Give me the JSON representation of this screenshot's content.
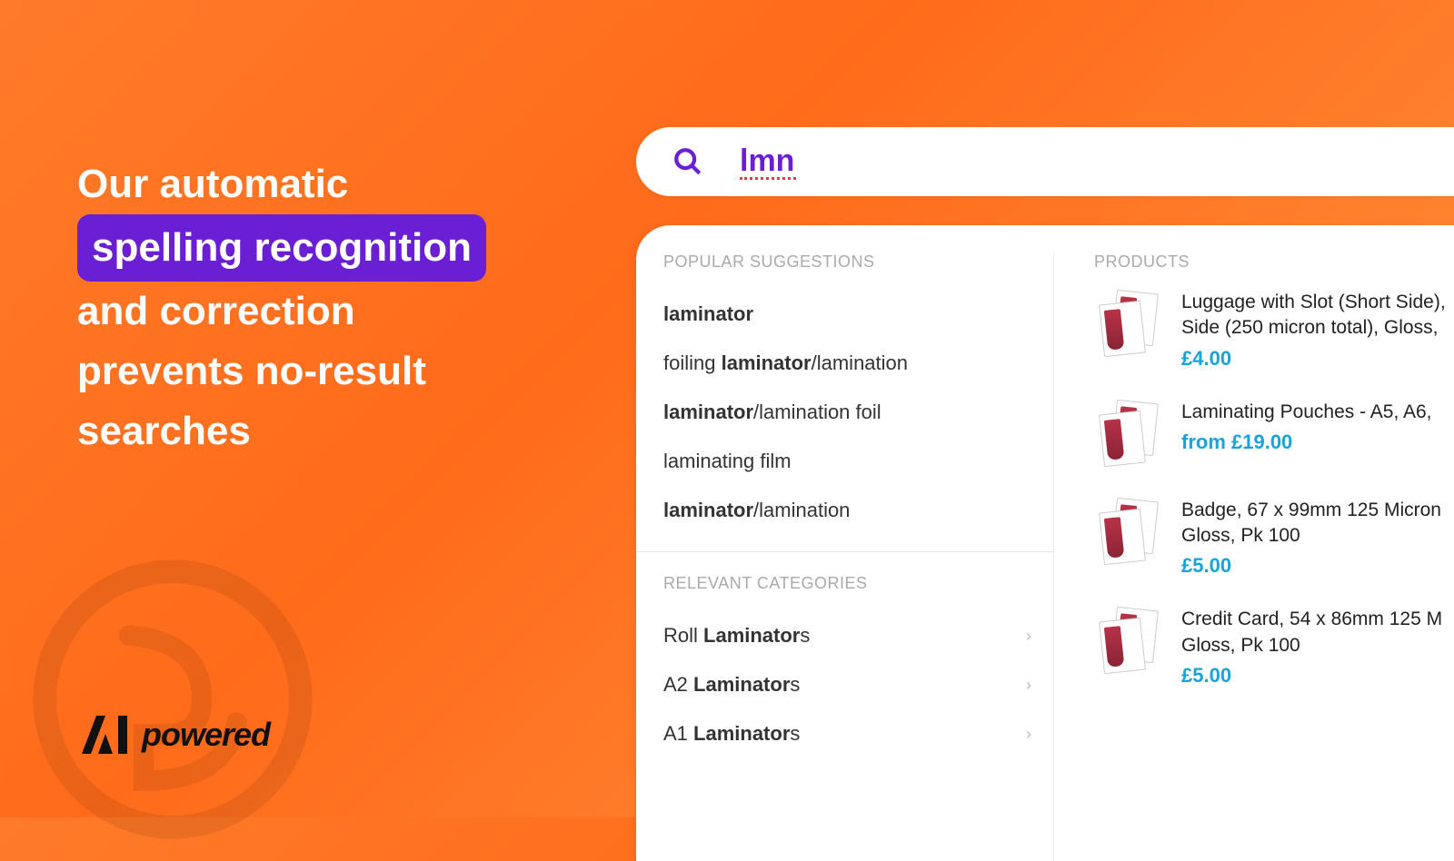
{
  "marketing": {
    "line1": "Our automatic",
    "highlight": "spelling recognition",
    "line3": "and correction",
    "line4": "prevents no-result",
    "line5": "searches"
  },
  "logo_text": "powered",
  "search": {
    "value": "lmn"
  },
  "sections": {
    "suggestions": "POPULAR SUGGESTIONS",
    "categories": "RELEVANT CATEGORIES",
    "products": "PRODUCTS"
  },
  "suggestions": [
    {
      "pre": "",
      "bold": "laminator",
      "post": ""
    },
    {
      "pre": "foiling ",
      "bold": "laminator",
      "post": "/lamination"
    },
    {
      "pre": "",
      "bold": "laminator",
      "post": "/lamination foil"
    },
    {
      "pre": "laminating film",
      "bold": "",
      "post": ""
    },
    {
      "pre": "",
      "bold": "laminator",
      "post": "/lamination"
    }
  ],
  "categories": [
    {
      "pre": "Roll ",
      "bold": "Laminator",
      "post": "s"
    },
    {
      "pre": "A2 ",
      "bold": "Laminator",
      "post": "s"
    },
    {
      "pre": "A1 ",
      "bold": "Laminator",
      "post": "s"
    }
  ],
  "products": [
    {
      "title": "Luggage with Slot (Short Side), Side (250 micron total), Gloss,",
      "price": "£4.00"
    },
    {
      "title": "Laminating Pouches - A5, A6,",
      "price": "from £19.00"
    },
    {
      "title": "Badge, 67 x 99mm 125 Micron Gloss, Pk 100",
      "price": "£5.00"
    },
    {
      "title": "Credit Card, 54 x 86mm 125 M Gloss, Pk 100",
      "price": "£5.00"
    }
  ]
}
